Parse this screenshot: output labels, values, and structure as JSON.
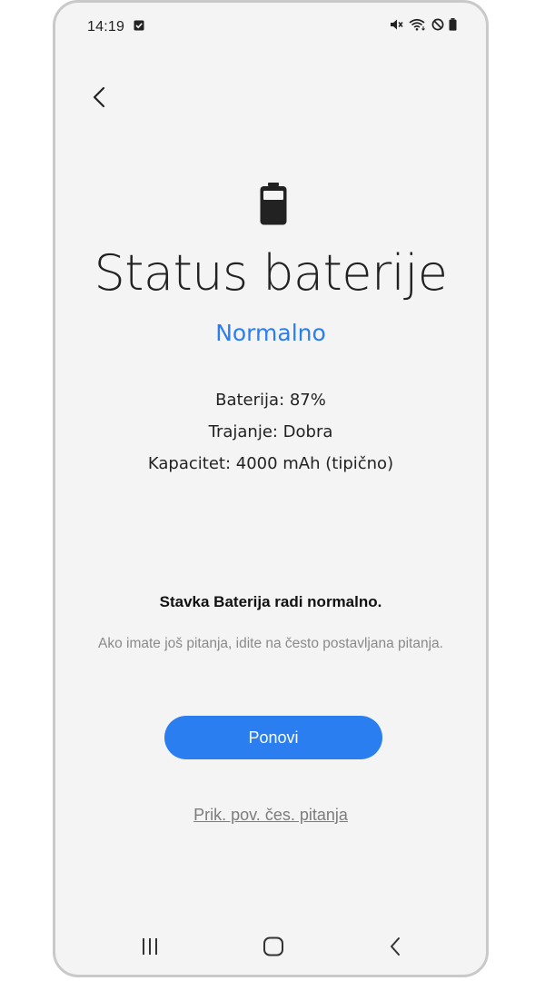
{
  "status_bar": {
    "time": "14:19",
    "icons": [
      "checkbox-notification-icon",
      "mute-icon",
      "wifi-icon",
      "do-not-disturb-icon",
      "battery-icon"
    ]
  },
  "header": {
    "back_icon": "chevron-left-icon"
  },
  "main": {
    "hero_icon": "battery-icon",
    "title": "Status baterije",
    "status": "Normalno",
    "battery_line": "Baterija: 87%",
    "duration_line": "Trajanje: Dobra",
    "capacity_line": "Kapacitet: 4000 mAh (tipično)",
    "message": "Stavka Baterija radi normalno.",
    "sub_message": "Ako imate još pitanja, idite na često postavljana pitanja.",
    "retry_label": "Ponovi",
    "faq_link": "Prik. pov. čes. pitanja"
  },
  "nav_bar": {
    "items": [
      "recent-apps-icon",
      "home-icon",
      "back-icon"
    ]
  },
  "colors": {
    "accent": "#2a7ef0",
    "background": "#f4f4f4",
    "text": "#222222",
    "muted": "#8a8a8a"
  }
}
